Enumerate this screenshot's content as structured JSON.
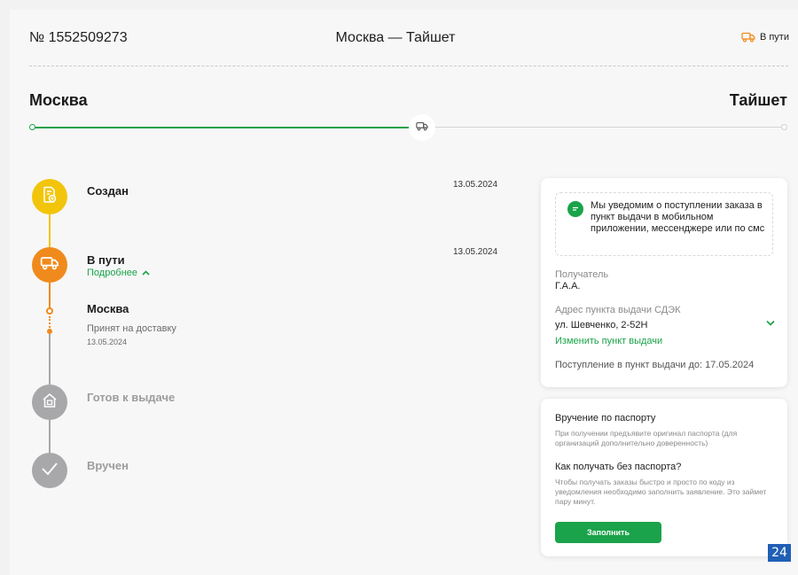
{
  "header": {
    "order_number": "№ 1552509273",
    "route": "Москва — Тайшет",
    "status": "В пути",
    "status_icon": "truck-icon",
    "status_color": "#f08a1c"
  },
  "route": {
    "from": "Москва",
    "to": "Тайшет",
    "progress": 0.52,
    "accent": "#1aa34a"
  },
  "timeline": {
    "created": {
      "title": "Создан",
      "date": "13.05.2024",
      "icon": "document-plus-icon"
    },
    "in_transit": {
      "title": "В пути",
      "date": "13.05.2024",
      "more": "Подробнее",
      "icon": "truck-icon"
    },
    "sub_event": {
      "city": "Москва",
      "description": "Принят на доставку",
      "date": "13.05.2024"
    },
    "ready": {
      "title": "Готов к выдаче",
      "icon": "house-icon"
    },
    "delivered": {
      "title": "Вручен",
      "icon": "check-icon"
    }
  },
  "panel_delivery": {
    "notice": "Мы уведомим о поступлении заказа в пункт выдачи в мобильном приложении, мессенджере или по смс",
    "recipient_label": "Получатель",
    "recipient": "Г.А.А.",
    "address_label": "Адрес пункта выдачи СДЭК",
    "address": "ул. Шевченко, 2-52Н",
    "change_link": "Изменить пункт выдачи",
    "deadline": "Поступление в пункт выдачи до: 17.05.2024"
  },
  "panel_passport": {
    "title": "Вручение по паспорту",
    "text": "При получении предъявите оригинал паспорта (для организаций дополнительно доверенность)",
    "question": "Как получать без паспорта?",
    "answer": "Чтобы получать заказы быстро и просто по коду из уведомления необходимо заполнить заявление. Это займет пару минут.",
    "button": "Заполнить"
  },
  "badge": "24"
}
